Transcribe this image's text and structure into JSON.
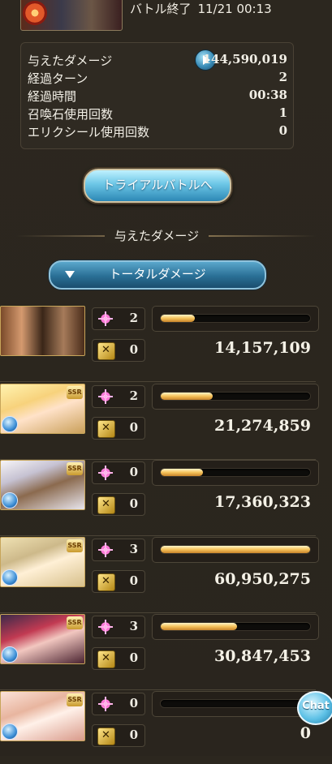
{
  "header": {
    "status": "バトル終了",
    "datetime": "11/21 00:13"
  },
  "stats": [
    {
      "label": "与えたダメージ",
      "value": "144,590,019"
    },
    {
      "label": "経過ターン",
      "value": "2"
    },
    {
      "label": "経過時間",
      "value": "00:38"
    },
    {
      "label": "召喚石使用回数",
      "value": "1"
    },
    {
      "label": "エリクシール使用回数",
      "value": "0"
    }
  ],
  "trial_button": "トライアルバトルへ",
  "section_title": "与えたダメージ",
  "total_damage_button": "トータルダメージ",
  "characters": [
    {
      "ougi": "2",
      "chain": "0",
      "damage": "14,157,109",
      "bar_fraction": 0.23
    },
    {
      "ougi": "2",
      "chain": "0",
      "damage": "21,274,859",
      "bar_fraction": 0.35
    },
    {
      "ougi": "0",
      "chain": "0",
      "damage": "17,360,323",
      "bar_fraction": 0.28
    },
    {
      "ougi": "3",
      "chain": "0",
      "damage": "60,950,275",
      "bar_fraction": 1.0
    },
    {
      "ougi": "3",
      "chain": "0",
      "damage": "30,847,453",
      "bar_fraction": 0.51
    },
    {
      "ougi": "0",
      "chain": "0",
      "damage": "0",
      "bar_fraction": 0.0
    }
  ],
  "ssr_badge": "SSR",
  "chat_button": "Chat",
  "colors": {
    "accent_blue": "#2a6f95",
    "bar_gold": "#f5c25a"
  }
}
